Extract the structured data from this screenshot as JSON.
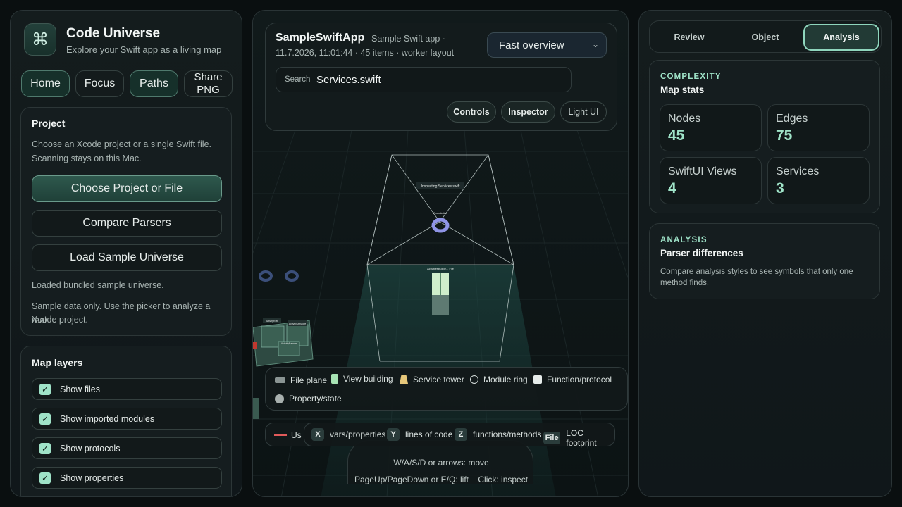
{
  "sidebar": {
    "app_icon": "command-icon",
    "app_icon_glyph": "⌘",
    "title": "Code Universe",
    "subtitle": "Explore your Swift app as a living map",
    "nav": [
      {
        "label": "Home",
        "active": true
      },
      {
        "label": "Focus",
        "active": false
      },
      {
        "label": "Paths",
        "active": true
      },
      {
        "label_line1": "Share",
        "label_line2": "PNG",
        "active": false
      }
    ],
    "project": {
      "title": "Project",
      "description_line1": "Choose an Xcode project or a single Swift file.",
      "description_line2": "Scanning stays on this Mac.",
      "choose_button": "Choose Project or File",
      "compare_button": "Compare Parsers",
      "load_button": "Load Sample Universe",
      "status": "Loaded bundled sample universe.",
      "note_line1": "Sample data only. Use the picker to analyze a real",
      "note_line2": "Xcode project."
    },
    "layers": {
      "title": "Map layers",
      "items": [
        {
          "label": "Show files",
          "checked": true
        },
        {
          "label": "Show imported modules",
          "checked": true
        },
        {
          "label": "Show protocols",
          "checked": true
        },
        {
          "label": "Show properties",
          "checked": true
        }
      ]
    }
  },
  "header": {
    "project_name": "SampleSwiftApp",
    "meta_line1": "Sample Swift app ·",
    "meta_line2": "11.7.2026, 11:01:44 · 45 items · worker layout",
    "mode_select": "Fast overview",
    "search_label": "Search",
    "search_value": "Services.swift",
    "toggles": [
      {
        "label": "Controls",
        "active": true
      },
      {
        "label": "Inspector",
        "active": true
      },
      {
        "label": "Light UI",
        "active": false
      }
    ]
  },
  "scene": {
    "labels": {
      "inspecting": "Inspecting Services.swift",
      "foundation": "Foundation",
      "active_building": "ActivitiesBuilde... File",
      "left_a": "ActivityRow",
      "left_b": "ActivityDefMore",
      "left_c": "ActivityBanner",
      "left_d": "ActivityServiceP"
    }
  },
  "legend": {
    "items": [
      {
        "label": "File plane",
        "icon": "file-plane-swatch"
      },
      {
        "label": "View building",
        "icon": "view-building-swatch"
      },
      {
        "label": "Service tower",
        "icon": "service-tower-swatch"
      },
      {
        "label": "Module ring",
        "icon": "module-ring-swatch"
      },
      {
        "label": "Function/protocol",
        "icon": "function-swatch"
      },
      {
        "label": "Property/state",
        "icon": "property-swatch"
      }
    ],
    "used_fragment": "Us",
    "axes": [
      {
        "key": "X",
        "label": "vars/properties"
      },
      {
        "key": "Y",
        "label": "lines of code"
      },
      {
        "key": "Z",
        "label": "functions/methods"
      },
      {
        "key": "File",
        "label": "LOC footprint"
      }
    ],
    "help_line1": "W/A/S/D or arrows: move",
    "help_line2": "PageUp/PageDown or E/Q: lift    Click: inspect"
  },
  "inspector": {
    "tabs": [
      {
        "label": "Review",
        "active": false
      },
      {
        "label": "Object",
        "active": false
      },
      {
        "label": "Analysis",
        "active": true
      }
    ],
    "complexity": {
      "kicker": "COMPLEXITY",
      "title": "Map stats",
      "stats": [
        {
          "label": "Nodes",
          "value": "45"
        },
        {
          "label": "Edges",
          "value": "75"
        },
        {
          "label": "SwiftUI Views",
          "value": "4"
        },
        {
          "label": "Services",
          "value": "3"
        }
      ]
    },
    "analysis": {
      "kicker": "ANALYSIS",
      "title": "Parser differences",
      "text_line1": "Compare analysis styles to see symbols that only one",
      "text_line2": "method finds."
    }
  },
  "colors": {
    "accent": "#9fe3c8",
    "background": "#0a0f10",
    "primary_button": "#2e584d"
  }
}
